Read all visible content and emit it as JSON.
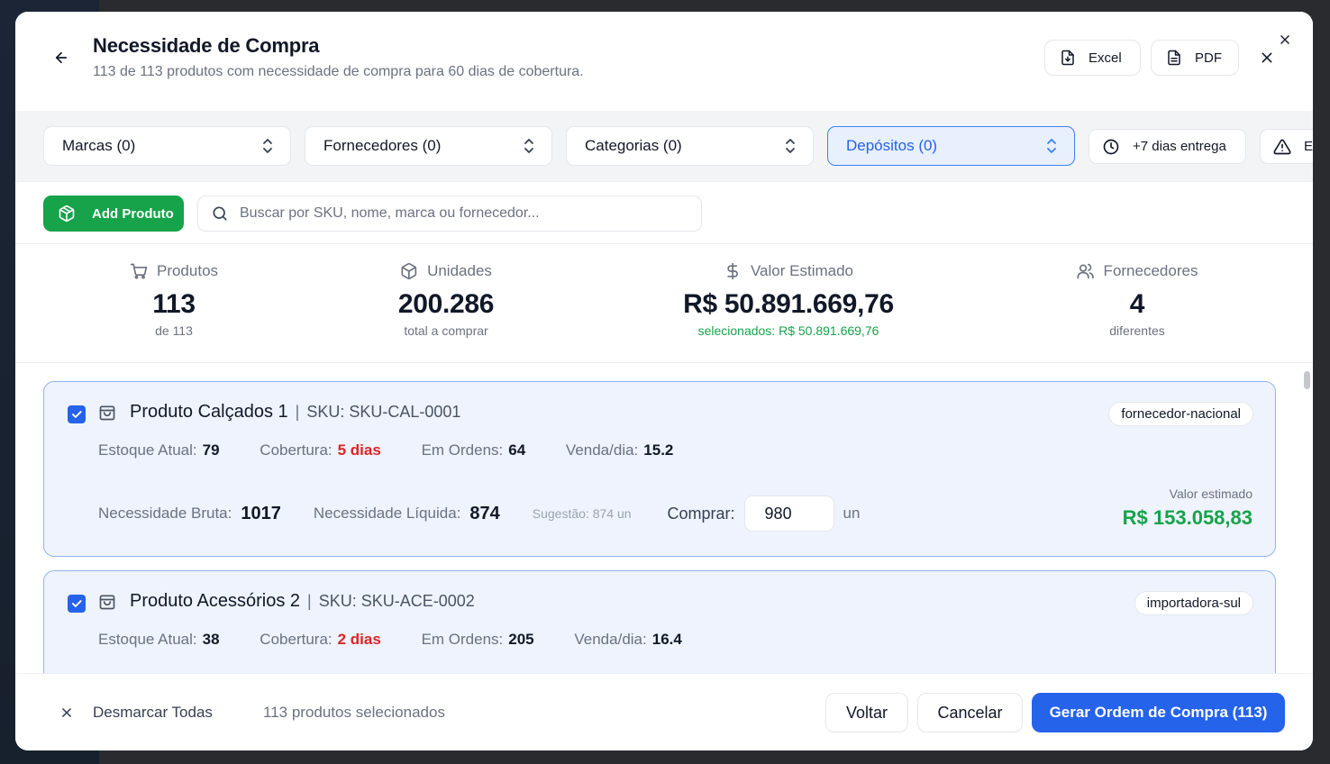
{
  "header": {
    "title": "Necessidade de Compra",
    "subtitle": "113 de 113 produtos com necessidade de compra para 60 dias de cobertura.",
    "excel_label": "Excel",
    "pdf_label": "PDF"
  },
  "filters": {
    "brands": "Marcas (0)",
    "suppliers": "Fornecedores (0)",
    "categories": "Categorias (0)",
    "warehouses": "Depósitos (0)",
    "delivery": "+7 dias entrega",
    "alert_partial": "E"
  },
  "toolbar": {
    "add_label": "Add Produto",
    "search_placeholder": "Buscar por SKU, nome, marca ou fornecedor..."
  },
  "stats": {
    "products": {
      "label": "Produtos",
      "value": "113",
      "sub": "de 113"
    },
    "units": {
      "label": "Unidades",
      "value": "200.286",
      "sub": "total a comprar"
    },
    "estimated": {
      "label": "Valor Estimado",
      "value": "R$ 50.891.669,76",
      "sub": "selecionados: R$ 50.891.669,76"
    },
    "suppliers": {
      "label": "Fornecedores",
      "value": "4",
      "sub": "diferentes"
    }
  },
  "products": [
    {
      "name": "Produto Calçados 1",
      "sku": "SKU: SKU-CAL-0001",
      "supplier": "fornecedor-nacional",
      "stock_label": "Estoque Atual:",
      "stock": "79",
      "coverage_label": "Cobertura:",
      "coverage": "5 dias",
      "orders_label": "Em Ordens:",
      "orders": "64",
      "sales_label": "Venda/dia:",
      "sales": "15.2",
      "gross_label": "Necessidade Bruta:",
      "gross": "1017",
      "net_label": "Necessidade Líquida:",
      "net": "874",
      "suggestion": "Sugestão: 874 un",
      "buy_label": "Comprar:",
      "buy_qty": "980",
      "unit": "un",
      "est_label": "Valor estimado",
      "est_value": "R$ 153.058,83"
    },
    {
      "name": "Produto Acessórios 2",
      "sku": "SKU: SKU-ACE-0002",
      "supplier": "importadora-sul",
      "stock_label": "Estoque Atual:",
      "stock": "38",
      "coverage_label": "Cobertura:",
      "coverage": "2 dias",
      "orders_label": "Em Ordens:",
      "orders": "205",
      "sales_label": "Venda/dia:",
      "sales": "16.4"
    }
  ],
  "footer": {
    "unmark_label": "Desmarcar Todas",
    "selected_count": "113 produtos selecionados",
    "back_label": "Voltar",
    "cancel_label": "Cancelar",
    "generate_label": "Gerar Ordem de Compra (113)"
  },
  "colors": {
    "primary": "#2563eb",
    "success": "#16a34a",
    "danger": "#dc2626",
    "card_bg": "#eef3fd"
  }
}
